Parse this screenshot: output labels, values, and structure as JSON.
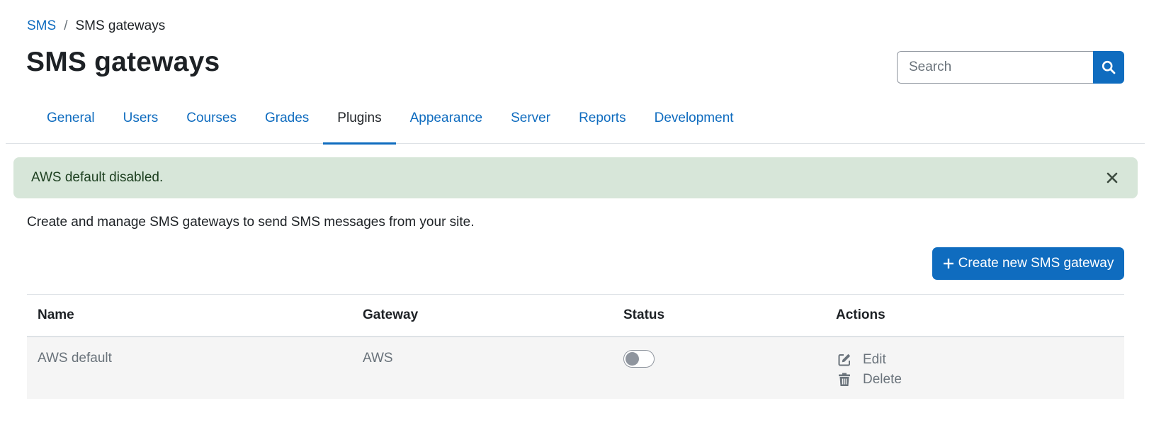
{
  "breadcrumb": {
    "parent": "SMS",
    "separator": "/",
    "current": "SMS gateways"
  },
  "page_title": "SMS gateways",
  "search": {
    "placeholder": "Search",
    "icon": "search-icon"
  },
  "tabs": [
    {
      "label": "General",
      "active": false
    },
    {
      "label": "Users",
      "active": false
    },
    {
      "label": "Courses",
      "active": false
    },
    {
      "label": "Grades",
      "active": false
    },
    {
      "label": "Plugins",
      "active": true
    },
    {
      "label": "Appearance",
      "active": false
    },
    {
      "label": "Server",
      "active": false
    },
    {
      "label": "Reports",
      "active": false
    },
    {
      "label": "Development",
      "active": false
    }
  ],
  "alert": {
    "message": "AWS default disabled.",
    "icon": "close-icon"
  },
  "intro_text": "Create and manage SMS gateways to send SMS messages from your site.",
  "create_button": {
    "label": "Create new SMS gateway",
    "icon": "plus-icon"
  },
  "table": {
    "headers": {
      "name": "Name",
      "gateway": "Gateway",
      "status": "Status",
      "actions": "Actions"
    },
    "rows": [
      {
        "name": "AWS default",
        "gateway": "AWS",
        "enabled": false,
        "actions": {
          "edit": "Edit",
          "delete": "Delete"
        }
      }
    ]
  },
  "colors": {
    "primary": "#0f6cbf",
    "text": "#1d2125",
    "muted": "#6a737b",
    "alert_bg": "#d7e6d9",
    "row_bg": "#f5f5f5"
  }
}
